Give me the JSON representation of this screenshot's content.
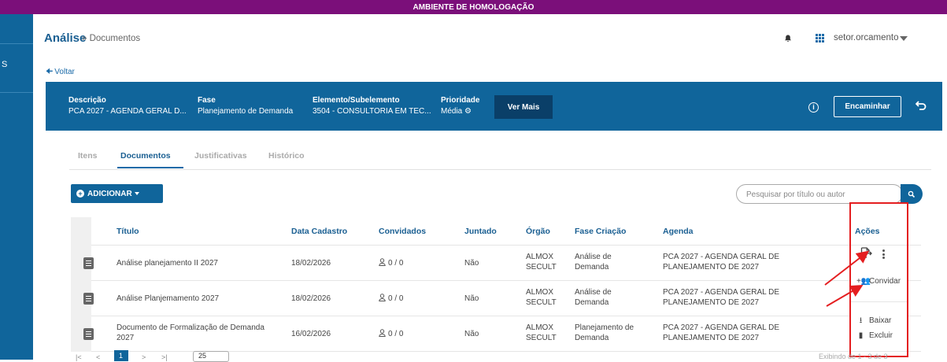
{
  "banner": "AMBIENTE DE HOMOLOGAÇÃO",
  "topbar": {
    "title": "Análise",
    "breadcrumb": "» Documentos",
    "user": "setor.orcamento"
  },
  "sidenav": {
    "fragment": "S"
  },
  "back_label": "Voltar",
  "summary": {
    "descricao_label": "Descrição",
    "descricao_value": "PCA 2027 - AGENDA GERAL D...",
    "fase_label": "Fase",
    "fase_value": "Planejamento de Demanda",
    "elemento_label": "Elemento/Subelemento",
    "elemento_value": "3504 - CONSULTORIA EM TEC...",
    "prioridade_label": "Prioridade",
    "prioridade_value": "Média",
    "ver_mais": "Ver Mais",
    "encaminhar": "Encaminhar"
  },
  "tabs": [
    "Itens",
    "Documentos",
    "Justificativas",
    "Histórico"
  ],
  "active_tab": "Documentos",
  "toolbar": {
    "add_label": "ADICIONAR",
    "search_placeholder": "Pesquisar por título ou autor"
  },
  "table": {
    "headers": [
      "Título",
      "Data Cadastro",
      "Convidados",
      "Juntado",
      "Órgão",
      "Fase Criação",
      "Agenda",
      "Ações"
    ],
    "rows": [
      {
        "titulo": [
          "Análise planejamento II 2027"
        ],
        "data": "18/02/2026",
        "convidados": "0 / 0",
        "juntado": "Não",
        "orgao": [
          "ALMOX",
          "SECULT"
        ],
        "fase": [
          "Análise de",
          "Demanda"
        ],
        "agenda": [
          "PCA 2027 - AGENDA GERAL DE",
          "PLANEJAMENTO DE 2027"
        ]
      },
      {
        "titulo": [
          "Análise Planjemamento 2027"
        ],
        "data": "18/02/2026",
        "convidados": "0 / 0",
        "juntado": "Não",
        "orgao": [
          "ALMOX",
          "SECULT"
        ],
        "fase": [
          "Análise de",
          "Demanda"
        ],
        "agenda": [
          "PCA 2027 - AGENDA GERAL DE",
          "PLANEJAMENTO DE 2027"
        ]
      },
      {
        "titulo": [
          "Documento de Formalização de Demanda",
          "2027"
        ],
        "data": "16/02/2026",
        "convidados": "0 / 0",
        "juntado": "Não",
        "orgao": [
          "ALMOX",
          "SECULT"
        ],
        "fase": [
          "Planejamento de",
          "Demanda"
        ],
        "agenda": [
          "PCA 2027 - AGENDA GERAL DE",
          "PLANEJAMENTO DE 2027"
        ]
      }
    ]
  },
  "actions_menu": [
    "Convidar",
    "Baixar",
    "Excluir"
  ],
  "pager": {
    "current_page": "1",
    "page_size": "25"
  },
  "footnote": "Exibindo de 1 - 3 de 3",
  "colors": {
    "banner": "#7b0f7a",
    "primary": "#10659b",
    "dark_button": "#0a3f68",
    "annotation": "#e41e20"
  },
  "icons": [
    "bell-icon",
    "grid-icon",
    "avatar-icon",
    "arrow-left-icon",
    "gear-icon",
    "info-icon",
    "undo-icon",
    "plus-circle-icon",
    "search-icon",
    "document-icon",
    "user-icon",
    "attach-file-icon",
    "kebab-icon",
    "add-people-icon",
    "download-icon",
    "trash-icon"
  ]
}
